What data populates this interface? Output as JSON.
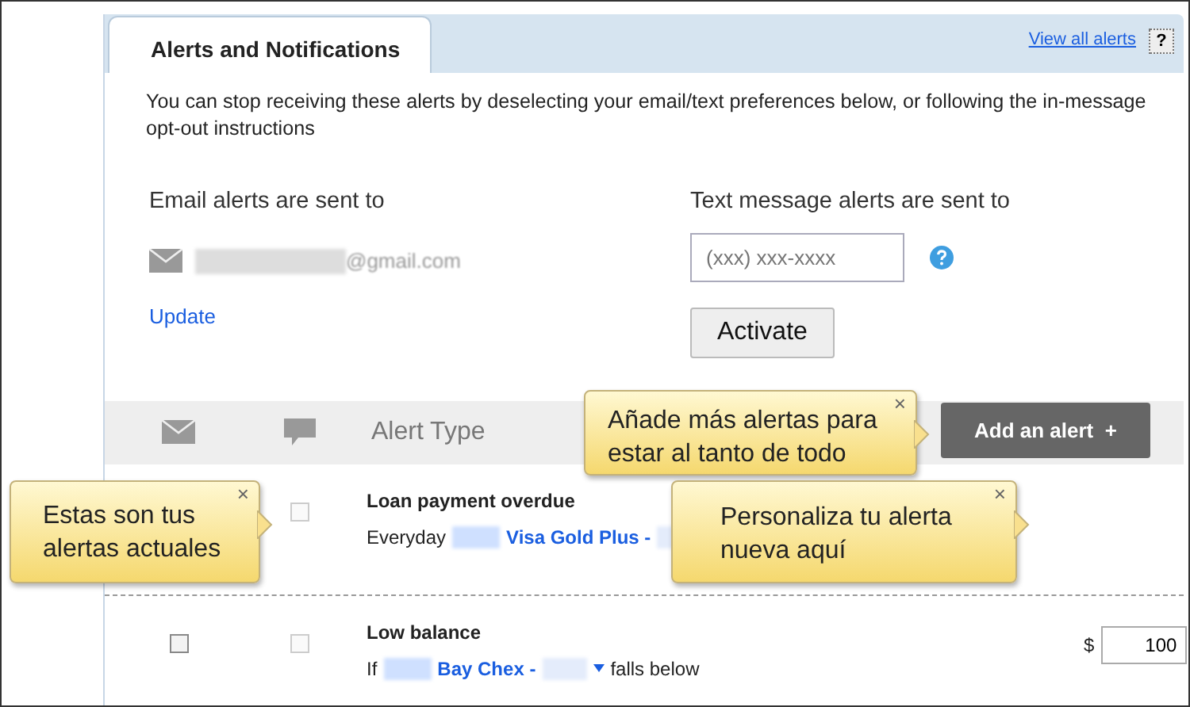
{
  "tab": {
    "label": "Alerts and Notifications",
    "selected": true
  },
  "header_links": {
    "view_all": "View all alerts",
    "help": "?"
  },
  "intro": "You can stop receiving these alerts by deselecting your email/text preferences below, or following the in-message opt-out instructions",
  "email": {
    "label": "Email alerts are sent to",
    "address": "@gmail.com",
    "update": "Update"
  },
  "text_message": {
    "label": "Text message alerts are sent to",
    "placeholder": "(xxx) xxx-xxxx",
    "activate": "Activate"
  },
  "table": {
    "column_3": "Alert Type",
    "add_button": "Add an alert",
    "add_icon": "+",
    "rows": [
      {
        "title": "Loan payment overdue",
        "prefix": "Everyday",
        "account": "Visa Gold Plus -",
        "suffix": "",
        "text_checked": false,
        "text_disabled": true
      },
      {
        "title": "Low balance",
        "prefix": "If",
        "account": "Bay Chex -",
        "suffix": "falls below",
        "currency": "$",
        "amount": "100",
        "email_checked": false,
        "email_disabled": false,
        "text_checked": false,
        "text_disabled": true
      }
    ]
  },
  "tooltips": [
    {
      "text": "Añade más alertas para estar al tanto de todo",
      "close": "×"
    },
    {
      "text": "Estas son tus alertas actuales",
      "close": "×"
    },
    {
      "text": "Personaliza tu alerta nueva aquí",
      "close": "×"
    }
  ]
}
